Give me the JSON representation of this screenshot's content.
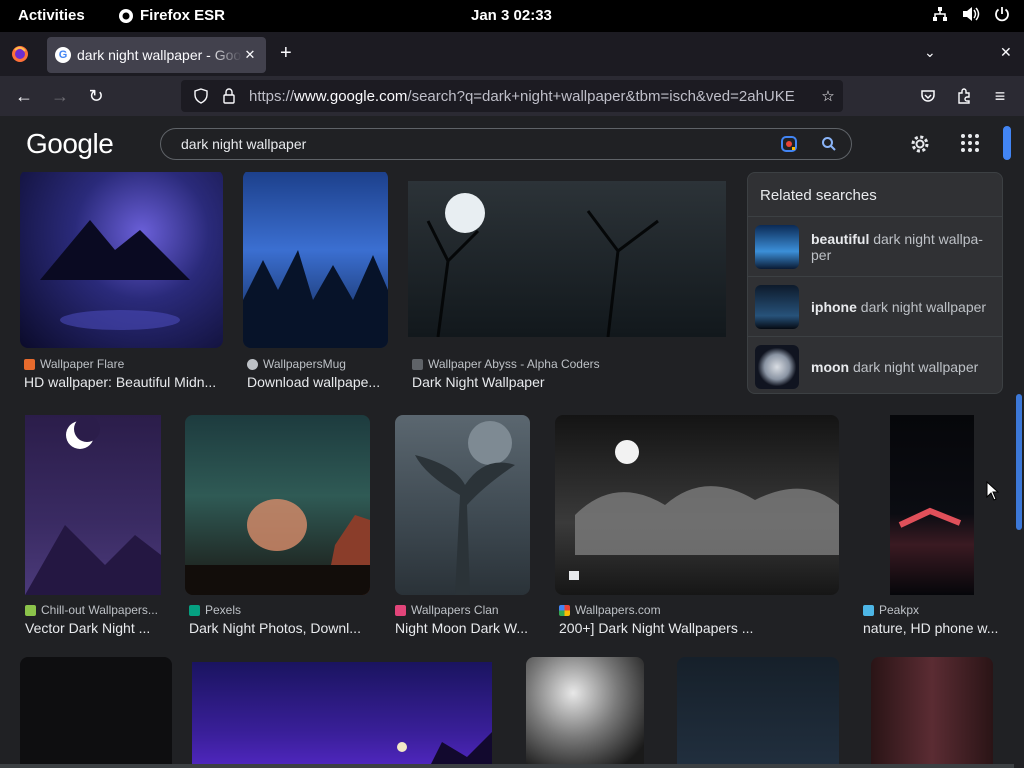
{
  "system": {
    "activities": "Activities",
    "app_name": "Firefox ESR",
    "clock": "Jan 3  02:33"
  },
  "browser": {
    "tab_title": "dark night wallpaper - Google Search",
    "url_prefix": "https://",
    "url_domain": "www.google.com",
    "url_rest": "/search?q=dark+night+wallpaper&tbm=isch&ved=2ahUKE"
  },
  "google": {
    "logo": "Google",
    "query": "dark night wallpaper",
    "colors": {
      "bg": "#202124",
      "panel": "#303134",
      "accent": "#4285f4"
    }
  },
  "related": {
    "heading": "Related searches",
    "items": [
      {
        "bold": "beautiful",
        "rest": " dark night wallpa-per"
      },
      {
        "bold": "iphone",
        "rest": " dark night wallpaper"
      },
      {
        "bold": "moon",
        "rest": " dark night wallpaper"
      }
    ]
  },
  "results": [
    {
      "source": "Wallpaper Flare",
      "caption": "HD wallpaper: Beautiful Midn..."
    },
    {
      "source": "WallpapersMug",
      "caption": "Download wallpape..."
    },
    {
      "source": "Wallpaper Abyss - Alpha Coders",
      "caption": "Dark Night Wallpaper"
    },
    {
      "source": "Chill-out Wallpapers...",
      "caption": "Vector Dark Night ..."
    },
    {
      "source": "Pexels",
      "caption": "Dark Night Photos, Downl..."
    },
    {
      "source": "Wallpapers Clan",
      "caption": "Night Moon Dark W..."
    },
    {
      "source": "Wallpapers.com",
      "caption": "200+] Dark Night Wallpapers ..."
    },
    {
      "source": "Peakpx",
      "caption": "nature, HD phone w..."
    }
  ]
}
